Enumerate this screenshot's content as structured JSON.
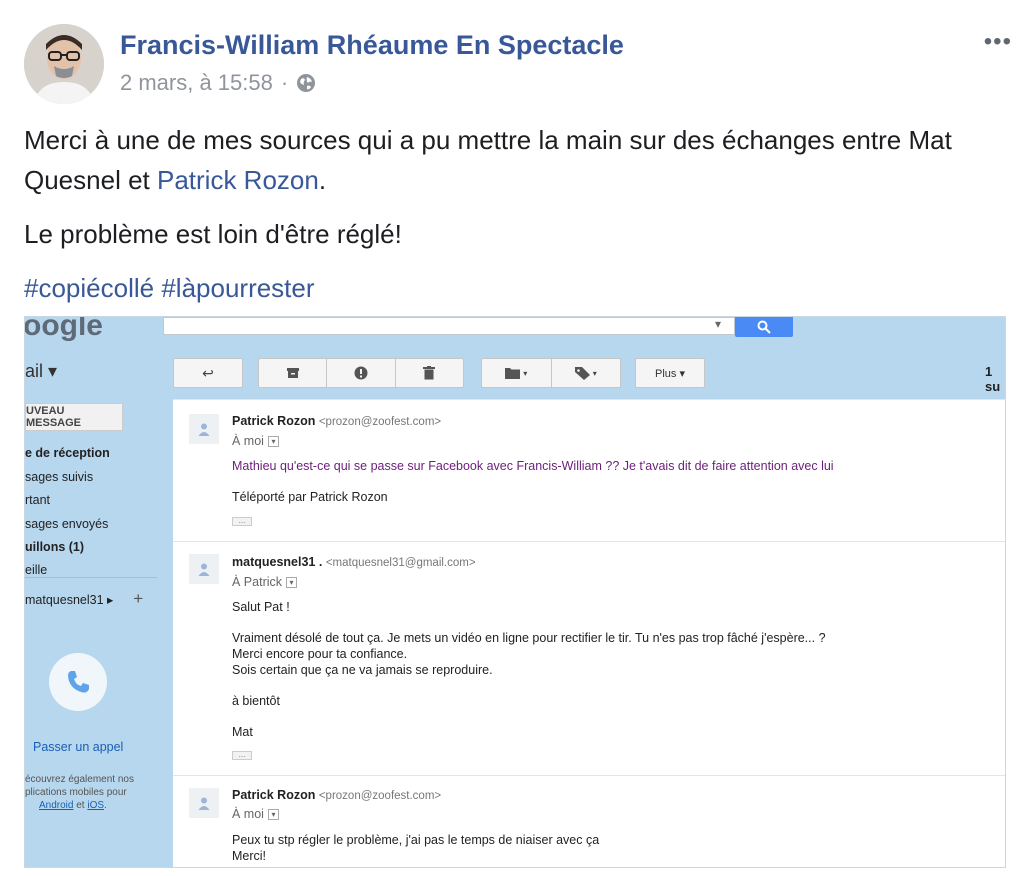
{
  "post": {
    "author": "Francis-William Rhéaume En Spectacle",
    "timestamp": "2 mars, à 15:58",
    "separator": "·",
    "privacy_icon": "globe-icon",
    "more_label": "•••",
    "text_line1": "Merci à une de mes sources qui a pu mettre la main sur des échanges entre Mat Quesnel et ",
    "mention": "Patrick Rozon",
    "mention_suffix": ".",
    "text_line2": "Le problème est loin d'être réglé!",
    "hashtag1": "#copiécollé",
    "hashtag2": "#làpourrester"
  },
  "gmail": {
    "logo_text": "oogle",
    "mail_label": "ail ▾",
    "toolbar": {
      "reply_icon": "↩",
      "archive_icon": "archive-icon",
      "spam_icon": "!",
      "delete_icon": "trash-icon",
      "move_icon": "folder-icon",
      "label_icon": "tag-icon",
      "more_label": "Plus ▾"
    },
    "count": "1 su",
    "compose": "UVEAU MESSAGE",
    "nav": [
      "e de réception",
      "sages suivis",
      "rtant",
      "sages envoyés",
      "uillons (1)",
      "eille"
    ],
    "hangout_user": "matquesnel31 ▸",
    "hangout_add": "+",
    "call_label": "Passer un appel",
    "discover_line1": "écouvrez également nos",
    "discover_line2": "plications mobiles pour",
    "discover_android": "Android",
    "discover_and": " et ",
    "discover_ios": "iOS",
    "discover_end": ".",
    "messages": [
      {
        "from_name": "Patrick Rozon",
        "from_email": "<prozon@zoofest.com>",
        "to": "À moi",
        "body1": "Mathieu qu'est-ce qui se passe sur Facebook avec Francis-William ?? Je t'avais dit de faire attention avec lui",
        "body2": "Téléporté par Patrick Rozon"
      },
      {
        "from_name": "matquesnel31 .",
        "from_email": "<matquesnel31@gmail.com>",
        "to": "À Patrick",
        "body1": "Salut Pat !",
        "body2": "Vraiment désolé de tout ça. Je mets un vidéo en ligne pour rectifier le tir. Tu n'es pas trop fâché j'espère... ?",
        "body3": "Merci encore pour ta confiance.",
        "body4": "Sois certain que ça ne va jamais se reproduire.",
        "body5": "à bientôt",
        "body6": "Mat"
      },
      {
        "from_name": "Patrick Rozon",
        "from_email": "<prozon@zoofest.com>",
        "to": "À moi",
        "body1": "Peux tu stp régler le problème,  j'ai pas le temps de niaiser avec ça",
        "body2": "Merci!"
      }
    ]
  },
  "colors": {
    "facebook_link": "#385898",
    "gmail_bg": "#b7d7ee",
    "gmail_blue": "#4a8af4"
  }
}
